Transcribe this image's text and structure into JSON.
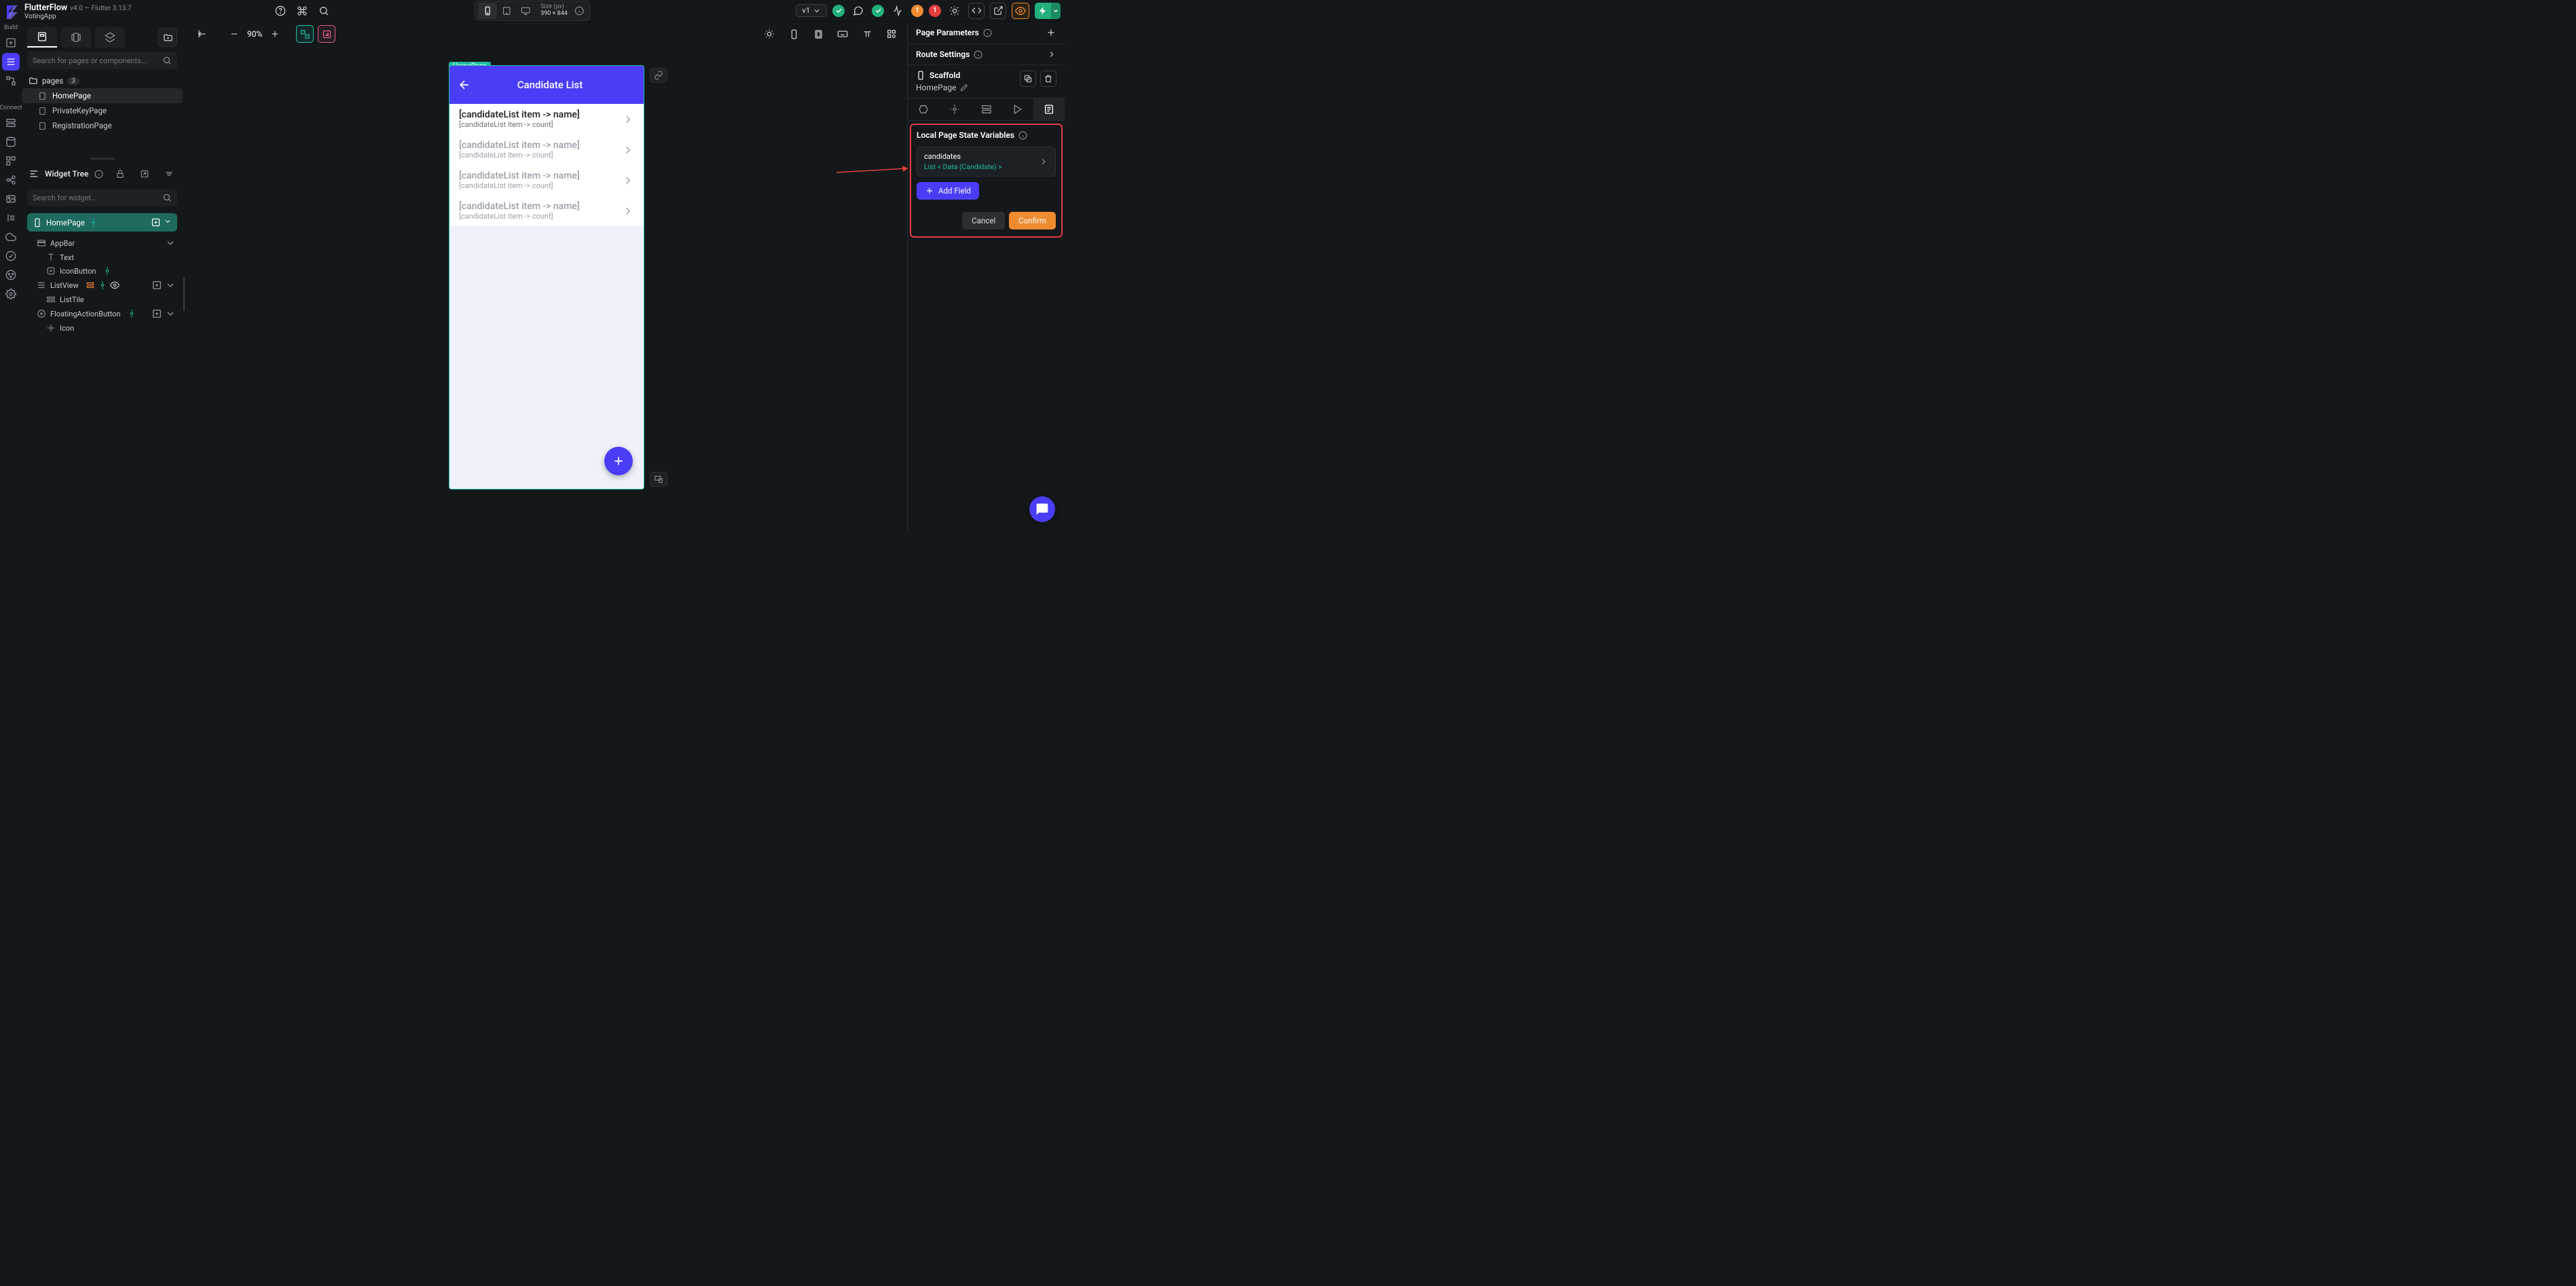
{
  "app": {
    "name": "FlutterFlow",
    "version": "v4.0 — Flutter 3.13.7",
    "project": "VotingApp"
  },
  "top": {
    "size_label": "Size (px)",
    "size_value": "390 × 844",
    "version_pill": "v1"
  },
  "rail": {
    "build_label": "Build",
    "connect_label": "Connect"
  },
  "pages_panel": {
    "search_placeholder": "Search for pages or components...",
    "pages_label": "pages",
    "pages_count": "3",
    "items": [
      {
        "name": "HomePage",
        "selected": true
      },
      {
        "name": "PrivateKeyPage",
        "selected": false
      },
      {
        "name": "RegistrationPage",
        "selected": false
      }
    ]
  },
  "widget_tree": {
    "title": "Widget Tree",
    "search_placeholder": "Search for widget...",
    "root": "HomePage",
    "nodes": {
      "appbar": "AppBar",
      "text": "Text",
      "iconbutton": "IconButton",
      "listview": "ListView",
      "listtile": "ListTile",
      "fab": "FloatingActionButton",
      "icon": "Icon"
    }
  },
  "canvas": {
    "zoom": "90%",
    "page_tag": "HomePage",
    "appbar_title": "Candidate List",
    "tile_title": "[candidateList item -> name]",
    "tile_subtitle": "[candidateList item -> count]"
  },
  "right": {
    "page_params": "Page Parameters",
    "route_settings": "Route Settings",
    "scaffold": "Scaffold",
    "scaffold_page": "HomePage",
    "state_title": "Local Page State Variables",
    "field": {
      "name": "candidates",
      "type": "List < Data (Candidate) >"
    },
    "add_field": "Add Field",
    "cancel": "Cancel",
    "confirm": "Confirm"
  }
}
